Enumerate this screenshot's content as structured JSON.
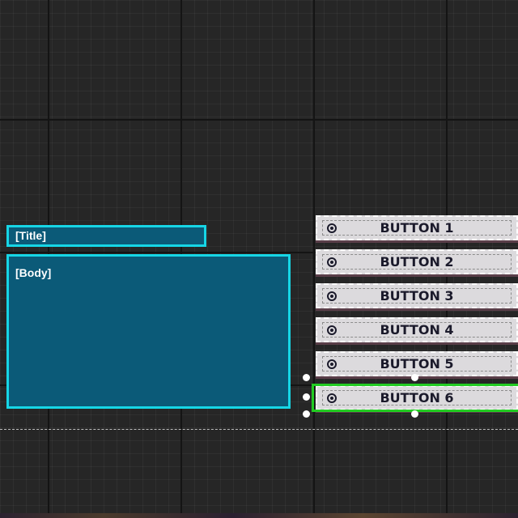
{
  "widgets": {
    "title_label": "[Title]",
    "body_label": "[Body]"
  },
  "buttons": [
    {
      "label": "BUTTON 1",
      "icon": "radio-target-icon"
    },
    {
      "label": "BUTTON 2",
      "icon": "radio-target-icon"
    },
    {
      "label": "BUTTON 3",
      "icon": "radio-target-icon"
    },
    {
      "label": "BUTTON 4",
      "icon": "radio-target-icon"
    },
    {
      "label": "BUTTON 5",
      "icon": "radio-target-icon"
    },
    {
      "label": "BUTTON 6",
      "icon": "radio-target-icon",
      "selected": true
    }
  ],
  "colors": {
    "canvas_bg": "#262626",
    "panel_fill": "#0b5a78",
    "panel_border": "#16d6e6",
    "button_bg": "#dcdadd",
    "button_text": "#1b1a2b",
    "selection": "#22cc22"
  }
}
